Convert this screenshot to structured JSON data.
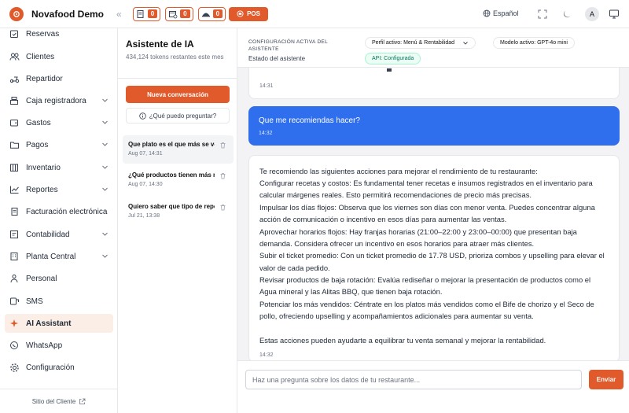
{
  "topbar": {
    "brand": "Novafood Demo",
    "counter1": "0",
    "counter2": "0",
    "counter3": "0",
    "pos_label": "POS",
    "language": "Español",
    "avatar_initial": "A",
    "accent_color": "#e05a2b"
  },
  "sidebar": {
    "items": [
      {
        "label": "Reservas",
        "icon": "calendar-check-icon"
      },
      {
        "label": "Clientes",
        "icon": "users-icon"
      },
      {
        "label": "Repartidor",
        "icon": "scooter-icon"
      },
      {
        "label": "Caja registradora",
        "icon": "cash-register-icon"
      },
      {
        "label": "Gastos",
        "icon": "wallet-icon"
      },
      {
        "label": "Pagos",
        "icon": "folder-icon"
      },
      {
        "label": "Inventario",
        "icon": "box-icon"
      },
      {
        "label": "Reportes",
        "icon": "chart-line-icon"
      },
      {
        "label": "Facturación electrónica",
        "icon": "document-icon"
      },
      {
        "label": "Contabilidad",
        "icon": "ledger-icon"
      },
      {
        "label": "Planta Central",
        "icon": "building-icon"
      },
      {
        "label": "Personal",
        "icon": "person-icon"
      },
      {
        "label": "SMS",
        "icon": "sms-icon"
      },
      {
        "label": "AI Assistant",
        "icon": "sparkle-icon"
      },
      {
        "label": "WhatsApp",
        "icon": "whatsapp-icon"
      },
      {
        "label": "Configuración",
        "icon": "gear-icon"
      }
    ],
    "footer_link": "Sitio del Cliente"
  },
  "conversations_panel": {
    "title": "Asistente de IA",
    "tokens_text": "434,124 tokens restantes este mes",
    "new_button": "Nueva conversación",
    "ask_button": "¿Qué puedo preguntar?",
    "items": [
      {
        "title": "Que plato es el que más se vende",
        "date": "Aug 07, 14:31"
      },
      {
        "title": "¿Qué productos tienen más margen",
        "date": "Aug 07, 14:30"
      },
      {
        "title": "Quiero saber que tipo de reporte",
        "date": "Jul 21, 13:38"
      }
    ]
  },
  "chat": {
    "config_label": "CONFIGURACIÓN ACTIVA DEL ASISTENTE",
    "status_label": "Estado del asistente",
    "profile_pill": "Perfil activo: Menú & Rentabilidad",
    "model_pill": "Modelo activo: GPT-4o mini",
    "api_pill": "API: Configurada",
    "messages": [
      {
        "time": "14:31"
      },
      {
        "text": "Que me recomiendas hacer?",
        "time": "14:32"
      },
      {
        "lines": [
          "Te recomiendo las siguientes acciones para mejorar el rendimiento de tu restaurante:",
          "Configurar recetas y costos: Es fundamental tener recetas e insumos registrados en el inventario para",
          "calcular márgenes reales. Esto permitirá recomendaciones de precio más precisas.",
          "Impulsar los días flojos: Observa que los viernes son días con menor venta. Puedes concentrar alguna",
          "acción de comunicación o incentivo en esos días para aumentar las ventas.",
          "Aprovechar horarios flojos: Hay franjas horarias (21:00–22:00 y 23:00–00:00) que presentan baja",
          "demanda. Considera ofrecer un incentivo en esos horarios para atraer más clientes.",
          "Subir el ticket promedio: Con un ticket promedio de 17.78 USD, prioriza combos y upselling para elevar el",
          "valor de cada pedido.",
          "Revisar productos de baja rotación: Evalúa rediseñar o mejorar la presentación de productos como el",
          "Agua mineral y las Alitas BBQ, que tienen baja rotación.",
          "Potenciar los más vendidos: Céntrate en los platos más vendidos como el Bife de chorizo y el Seco de",
          "pollo, ofreciendo upselling y acompañamientos adicionales para aumentar su venta.",
          "",
          "Estas acciones pueden ayudarte a equilibrar tu venta semanal y mejorar la rentabilidad."
        ],
        "time": "14:32"
      }
    ],
    "input_placeholder": "Haz una pregunta sobre los datos de tu restaurante...",
    "input_value": "",
    "send_button": "Enviar",
    "user_bubble_color": "#2f6fed"
  }
}
